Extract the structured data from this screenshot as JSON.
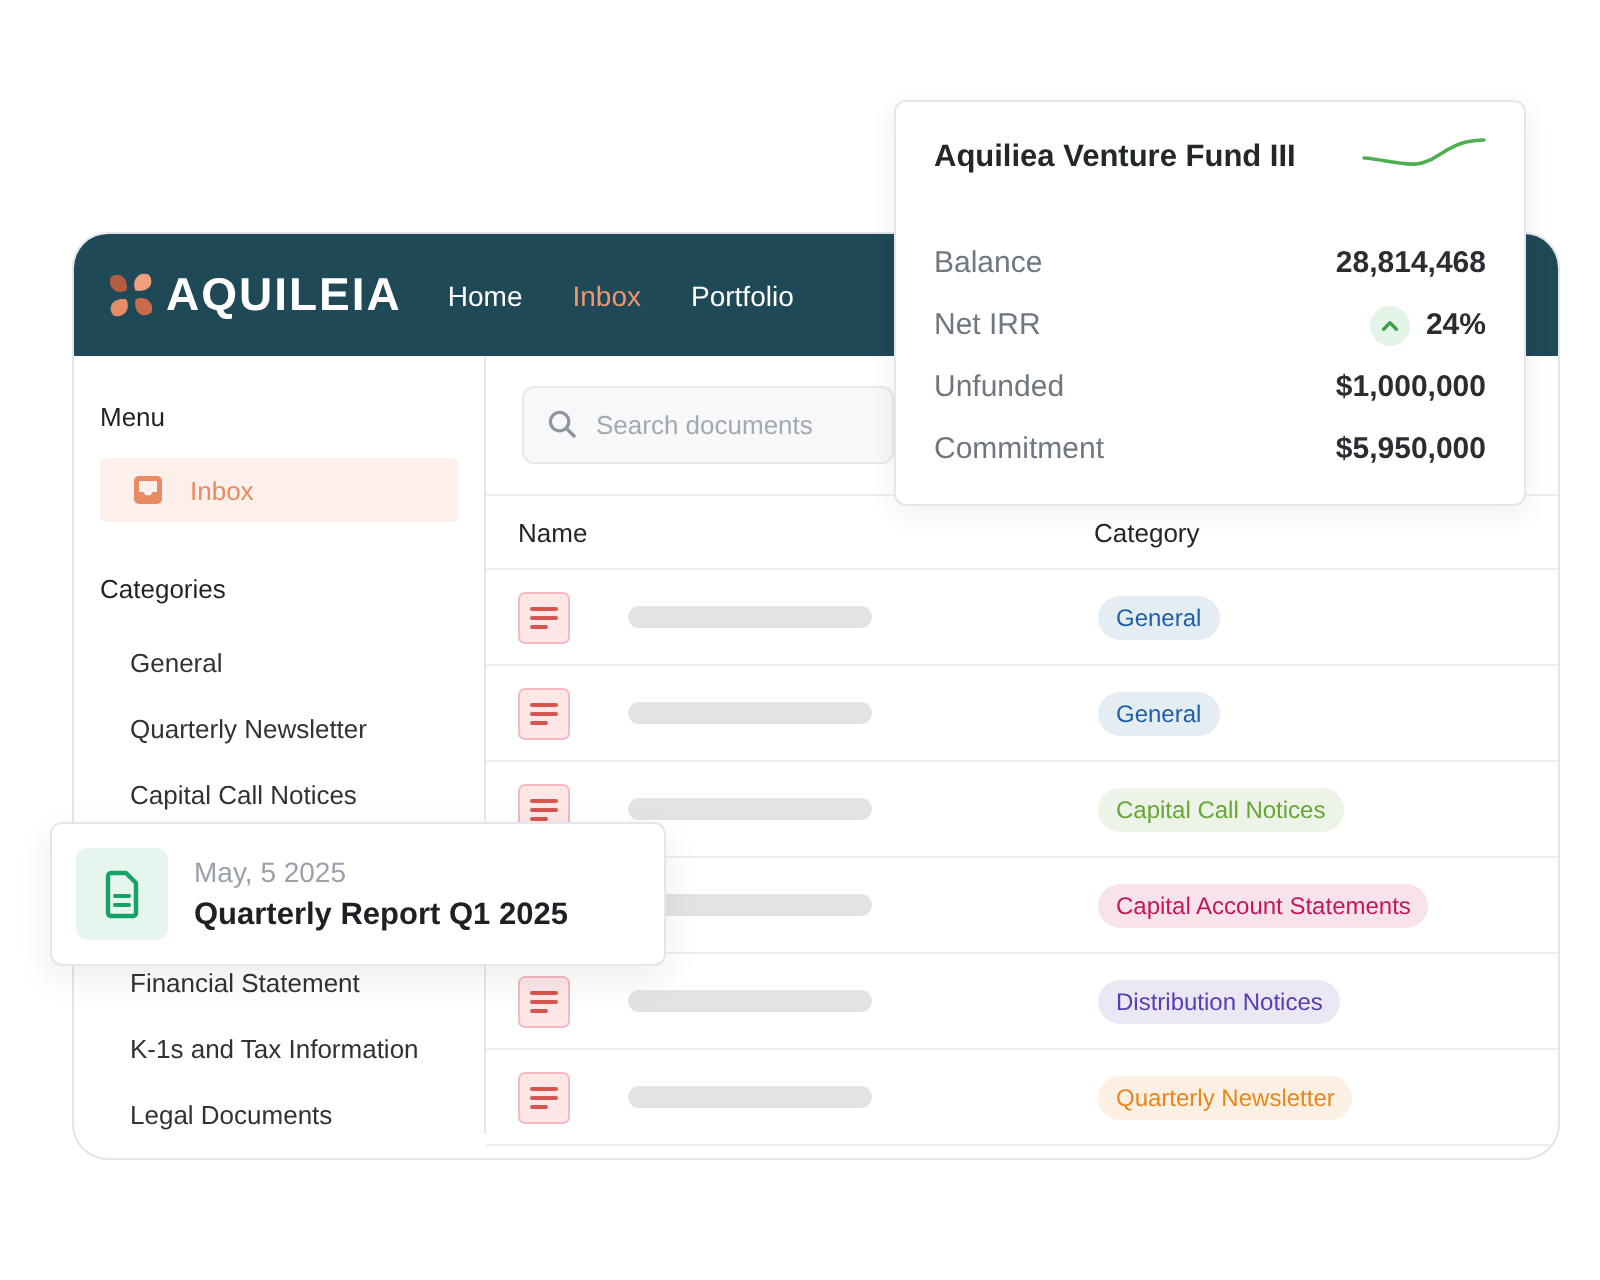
{
  "header": {
    "logo": "AQUILEIA",
    "nav": [
      {
        "label": "Home",
        "selected": false
      },
      {
        "label": "Inbox",
        "selected": true
      },
      {
        "label": "Portfolio",
        "selected": false
      }
    ]
  },
  "sidebar": {
    "menu_heading": "Menu",
    "menu_items": [
      {
        "label": "Inbox",
        "selected": true
      }
    ],
    "categories_heading": "Categories",
    "categories": [
      {
        "label": "General",
        "selected": false
      },
      {
        "label": "Quarterly Newsletter",
        "selected": false
      },
      {
        "label": "Capital Call Notices",
        "selected": false
      },
      {
        "label": "Financial Statement",
        "selected": false
      },
      {
        "label": "K-1s and Tax Information",
        "selected": false
      },
      {
        "label": "Legal Documents",
        "selected": false
      }
    ]
  },
  "search": {
    "placeholder": "Search documents"
  },
  "table": {
    "columns": [
      "Name",
      "Category"
    ],
    "rows": [
      {
        "category": "General",
        "color": "#1f5fa6"
      },
      {
        "category": "General",
        "color": "#1f5fa6"
      },
      {
        "category": "Capital Call Notices",
        "color": "#66a536"
      },
      {
        "category": "Capital Account Statements",
        "color": "#c2185b"
      },
      {
        "category": "Distribution Notices",
        "color": "#5b3cb0"
      },
      {
        "category": "Quarterly Newsletter",
        "color": "#e8861a"
      }
    ]
  },
  "fund_card": {
    "title": "Aquiliea Venture Fund III",
    "stats": [
      {
        "label": "Balance",
        "value": "28,814,468"
      },
      {
        "label": "Net IRR",
        "value": "24%",
        "trend_up": true
      },
      {
        "label": "Unfunded",
        "value": "$1,000,000"
      },
      {
        "label": "Commitment",
        "value": "$5,950,000"
      }
    ]
  },
  "notification": {
    "date": "May, 5 2025",
    "title": "Quarterly Report Q1 2025"
  }
}
